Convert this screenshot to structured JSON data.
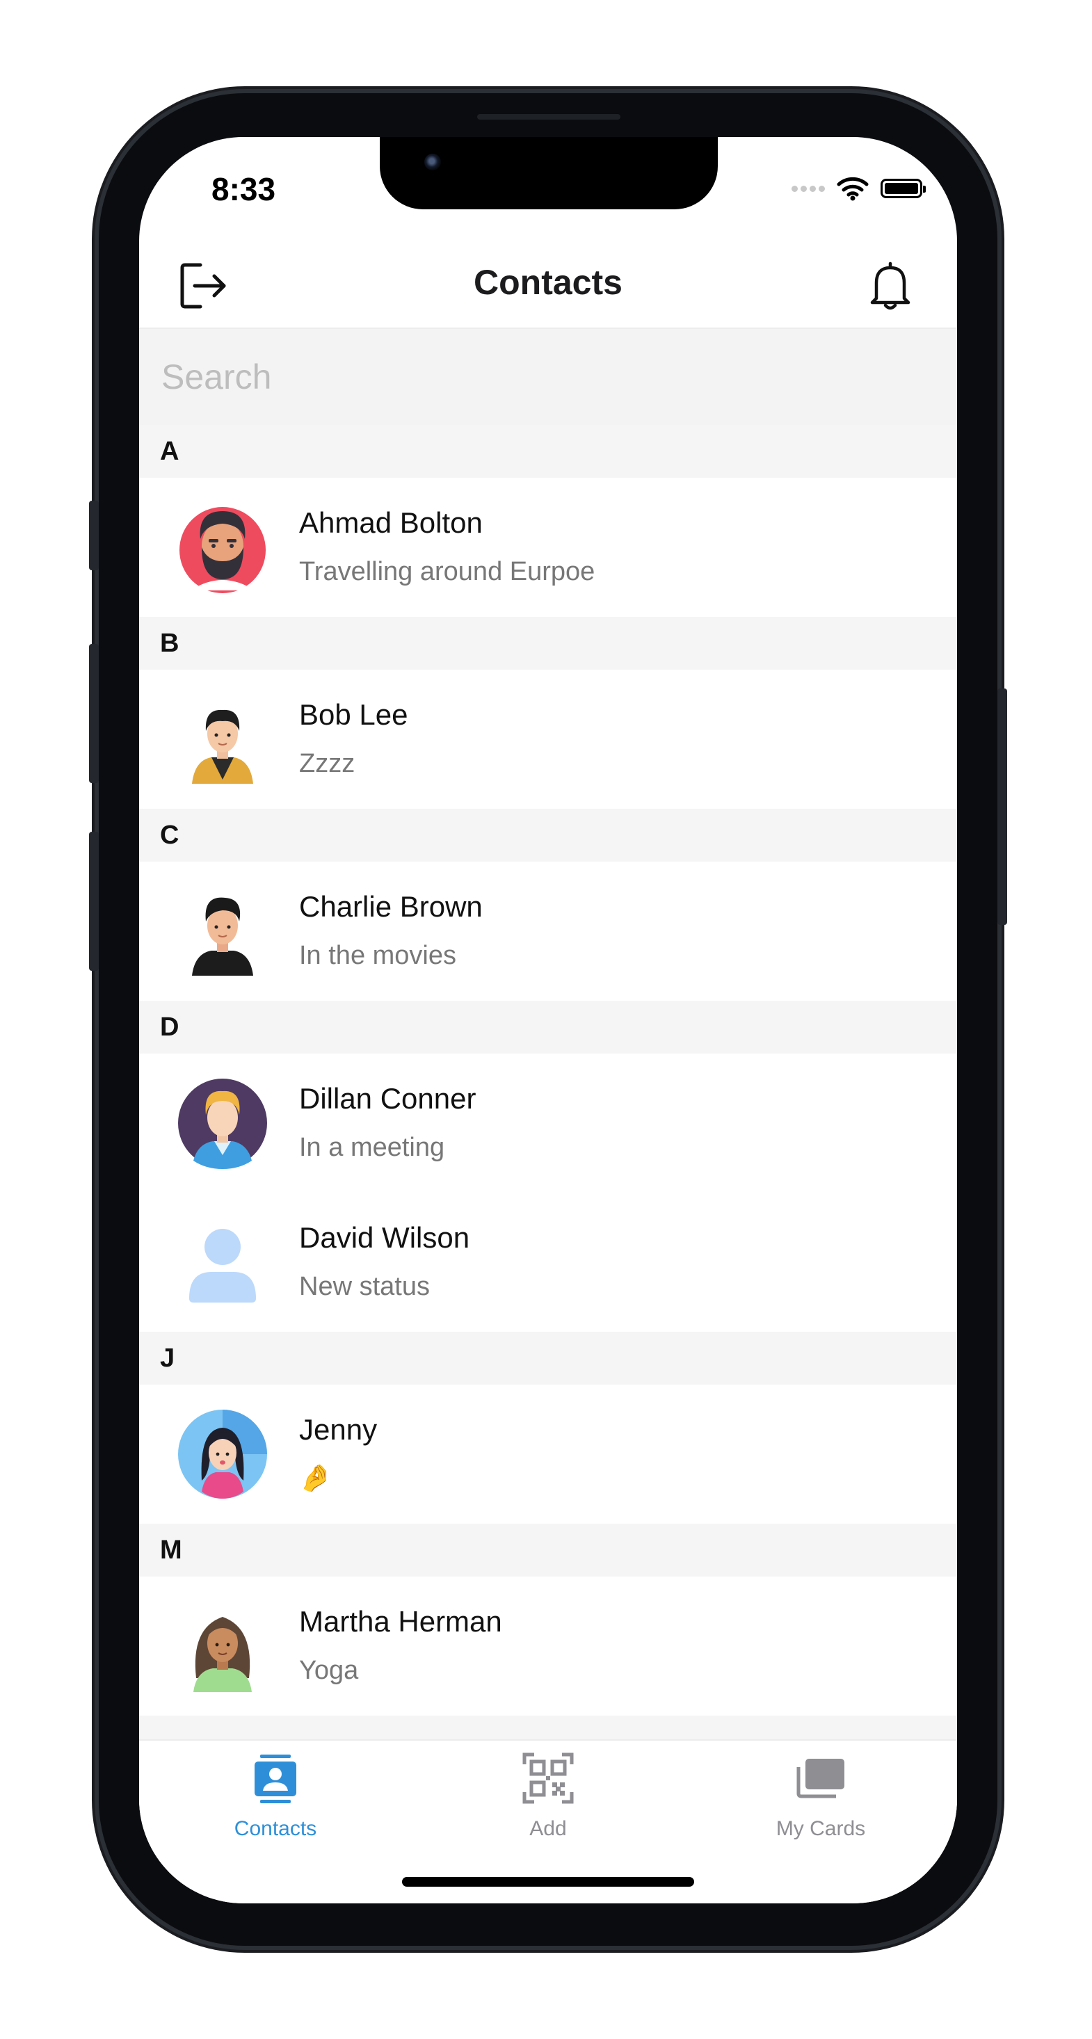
{
  "status_bar": {
    "time": "8:33"
  },
  "header": {
    "title": "Contacts"
  },
  "search": {
    "placeholder": "Search",
    "value": ""
  },
  "sections": [
    {
      "letter": "A",
      "contacts": [
        {
          "name": "Ahmad Bolton",
          "status": "Travelling around Eurpoe"
        }
      ]
    },
    {
      "letter": "B",
      "contacts": [
        {
          "name": "Bob Lee",
          "status": "Zzzz"
        }
      ]
    },
    {
      "letter": "C",
      "contacts": [
        {
          "name": "Charlie Brown",
          "status": "In the movies"
        }
      ]
    },
    {
      "letter": "D",
      "contacts": [
        {
          "name": "Dillan Conner",
          "status": "In a meeting"
        },
        {
          "name": "David Wilson",
          "status": "New status"
        }
      ]
    },
    {
      "letter": "J",
      "contacts": [
        {
          "name": "Jenny",
          "status": "🤌"
        }
      ]
    },
    {
      "letter": "M",
      "contacts": [
        {
          "name": "Martha Herman",
          "status": "Yoga"
        }
      ]
    }
  ],
  "tabs": [
    {
      "label": "Contacts",
      "icon": "contacts-icon",
      "active": true
    },
    {
      "label": "Add",
      "icon": "qr-code-icon",
      "active": false
    },
    {
      "label": "My Cards",
      "icon": "cards-icon",
      "active": false
    }
  ],
  "colors": {
    "accent": "#2e8fd8",
    "inactive": "#8e8e93",
    "section_bg": "#f5f5f5",
    "search_bg": "#f3f3f3"
  }
}
